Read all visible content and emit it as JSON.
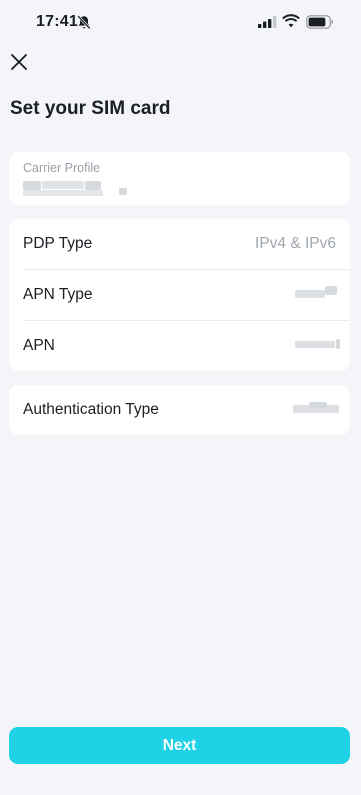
{
  "status_bar": {
    "time": "17:41",
    "icons": [
      "bell-slash-icon",
      "cellular-signal-icon",
      "wifi-icon",
      "battery-icon"
    ]
  },
  "header": {
    "close_icon": "close-icon",
    "title": "Set your SIM card"
  },
  "carrier_profile": {
    "label": "Carrier Profile",
    "value": ""
  },
  "settings": [
    {
      "label": "PDP Type",
      "value": "IPv4 & IPv6"
    },
    {
      "label": "APN Type",
      "value": ""
    },
    {
      "label": "APN",
      "value": ""
    }
  ],
  "authentication": {
    "label": "Authentication Type",
    "value": ""
  },
  "footer": {
    "next_label": "Next"
  },
  "colors": {
    "background": "#f3f5f9",
    "card": "#ffffff",
    "accent": "#1fd2e6",
    "muted_text": "#a0a6ae"
  }
}
